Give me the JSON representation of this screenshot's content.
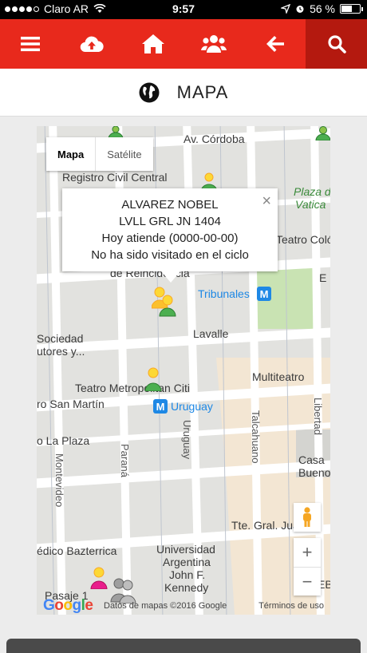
{
  "status_bar": {
    "carrier": "Claro AR",
    "time": "9:57",
    "battery": "56 %",
    "signal_bars_filled": 4,
    "battery_level": 0.56
  },
  "toolbar": {
    "items": [
      {
        "icon": "menu-icon"
      },
      {
        "icon": "cloud-upload-icon"
      },
      {
        "icon": "home-icon"
      },
      {
        "icon": "group-icon"
      },
      {
        "icon": "back-arrow-icon"
      },
      {
        "icon": "search-icon"
      }
    ],
    "color": "#e8291c",
    "active_color": "#b4190f"
  },
  "header": {
    "title": "MAPA",
    "icon": "globe-icon"
  },
  "map": {
    "map_type": {
      "map_label": "Mapa",
      "satellite_label": "Satélite",
      "selected": "Mapa"
    },
    "info_window": {
      "line1": "ALVAREZ NOBEL",
      "line2": "LVLL GRL JN 1404",
      "line3": "Hoy atiende (0000-00-00)",
      "line4": "No ha sido visitado en el ciclo",
      "close": "×"
    },
    "labels": {
      "av_cordoba": "Av. Córdoba",
      "registro": "Registro Civil Central",
      "plaza_1": "Plaza de",
      "plaza_2": "Vatica",
      "teatro_colon": "Teatro Colón",
      "reincidencia": "de Reincidencia",
      "tribunales": "Tribunales",
      "lavalle": "Lavalle",
      "sociedad": "Sociedad",
      "autores": "utores y...",
      "multiteatro": "Multiteatro",
      "metropolitan": "Teatro Metropolitan Citi",
      "san_martin": "ro San Martín",
      "uruguay_station": "Uruguay",
      "uruguay_street": "Uruguay",
      "talcahuano": "Talcahuano",
      "libertad": "Libertad",
      "la_plaza": "o La Plaza",
      "parana": "Paraná",
      "montevideo": "Montevideo",
      "casa_1": "Casa",
      "casa_2": "Bueno",
      "tte_gral": "Tte. Gral. Juan D",
      "bazterrica": "édico Bazterrica",
      "universidad_1": "Universidad",
      "universidad_2": "Argentina",
      "universidad_3": "John F.",
      "universidad_4": "Kennedy",
      "pasaje": "Pasaje 1",
      "metro_letter": "M",
      "edge_e": "E",
      "edge_eb": "EB"
    },
    "controls": {
      "zoom_in": "+",
      "zoom_out": "−"
    },
    "attribution": {
      "logo": "Google",
      "data": "Datos de mapas ©2016 Google",
      "terms": "Términos de uso"
    }
  }
}
